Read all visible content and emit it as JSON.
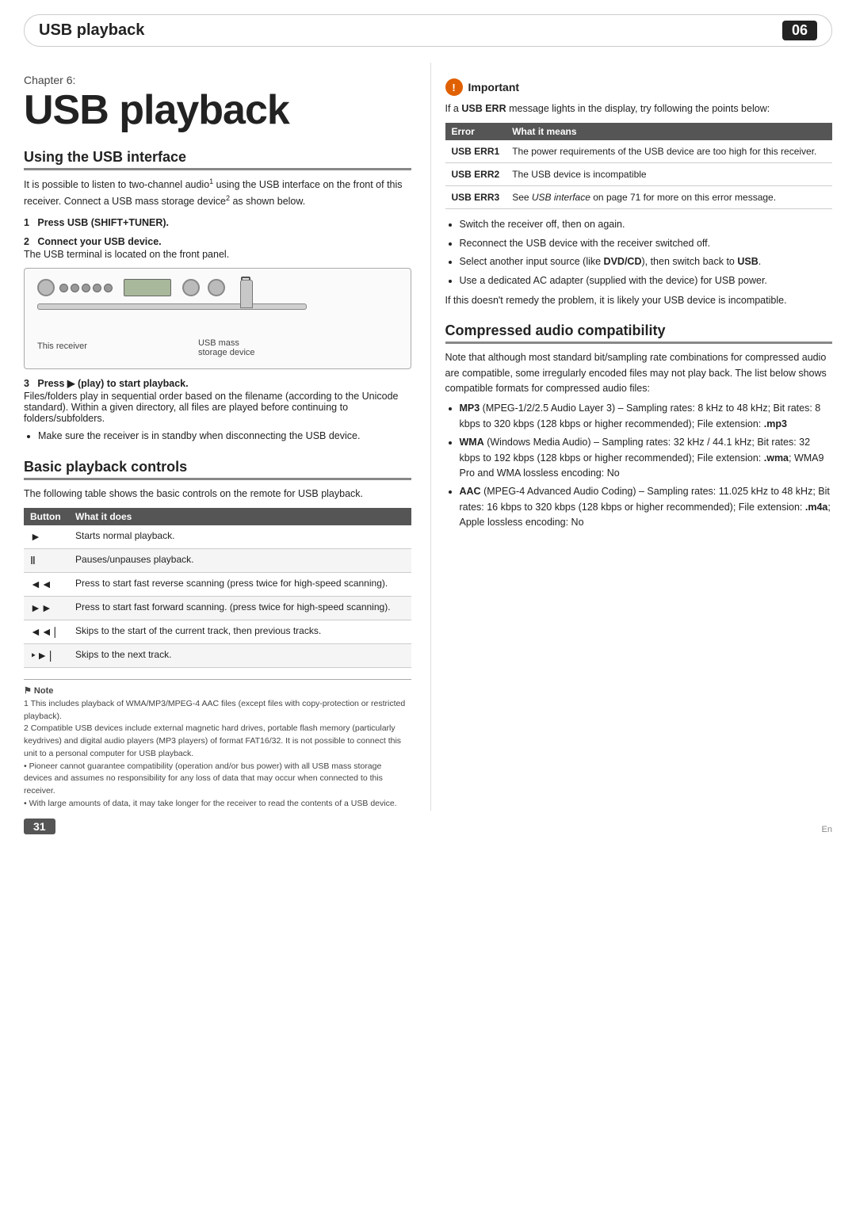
{
  "header": {
    "title": "USB playback",
    "chapter_num": "06"
  },
  "chapter": {
    "label": "Chapter 6:",
    "title": "USB playback"
  },
  "left_col": {
    "section1": {
      "heading": "Using the USB interface",
      "body": "It is possible to listen to two-channel audio¹ using the USB interface on the front of this receiver. Connect a USB mass storage device² as shown below.",
      "step1": {
        "label": "1   Press USB (SHIFT+TUNER)."
      },
      "step2": {
        "label": "2   Connect your USB device.",
        "body": "The USB terminal is located on the front panel."
      },
      "diagram": {
        "receiver_label": "This receiver",
        "usb_label": "USB mass\nstorage device"
      },
      "step3": {
        "label": "3   Press ► (play) to start playback.",
        "body": "Files/folders play in sequential order based on the filename (according to the Unicode standard). Within a given directory, all files are played before continuing to folders/subfolders."
      },
      "bullet": "Make sure the receiver is in standby when disconnecting the USB device."
    },
    "section2": {
      "heading": "Basic playback controls",
      "intro": "The following table shows the basic controls on the remote for USB playback.",
      "table": {
        "col1": "Button",
        "col2": "What it does",
        "rows": [
          {
            "button": "►",
            "desc": "Starts normal playback."
          },
          {
            "button": "Ⅱ",
            "desc": "Pauses/unpauses playback."
          },
          {
            "button": "◄◄",
            "desc": "Press to start fast reverse scanning (press twice for high-speed scanning)."
          },
          {
            "button": "►►",
            "desc": "Press to start fast forward scanning.\n(press twice for high-speed scanning)."
          },
          {
            "button": "◄◄∣",
            "desc": "Skips to the start of the current track, then previous tracks."
          },
          {
            "button": "‣►∣",
            "desc": "Skips to the next track."
          }
        ]
      }
    },
    "note": {
      "title": "Note",
      "lines": [
        "1  This includes playback of WMA/MP3/MPEG-4 AAC files (except files with copy-protection or restricted playback).",
        "2  Compatible USB devices include external magnetic hard drives, portable flash memory (particularly keydrives) and digital audio players (MP3 players) of format FAT16/32. It is not possible to connect this unit to a personal computer for USB playback.",
        "   • Pioneer cannot guarantee compatibility (operation and/or bus power) with all USB mass storage devices and assumes no responsibility for any loss of data that may occur when connected to this receiver.",
        "   • With large amounts of data, it may take longer for the receiver to read the contents of a USB device."
      ]
    }
  },
  "right_col": {
    "important": {
      "header": "Important",
      "intro": "If a USB ERR message lights in the display, try following the points below:",
      "table": {
        "col1": "Error",
        "col2": "What it means",
        "rows": [
          {
            "error": "USB ERR1",
            "desc": "The power requirements of the USB device are too high for this receiver."
          },
          {
            "error": "USB ERR2",
            "desc": "The USB device is incompatible"
          },
          {
            "error": "USB ERR3",
            "desc": "See USB interface on page 71 for more on this error message."
          }
        ]
      },
      "bullets": [
        "Switch the receiver off, then on again.",
        "Reconnect the USB device with the receiver switched off.",
        "Select another input source (like DVD/CD), then switch back to USB.",
        "Use a dedicated AC adapter (supplied with the device) for USB power."
      ],
      "footer_text": "If this doesn't remedy the problem, it is likely your USB device is incompatible."
    },
    "section_compressed": {
      "heading": "Compressed audio compatibility",
      "intro": "Note that although most standard bit/sampling rate combinations for compressed audio are compatible, some irregularly encoded files may not play back. The list below shows compatible formats for compressed audio files:",
      "bullets": [
        {
          "bold_start": "MP3",
          "rest": " (MPEG-1/2/2.5 Audio Layer 3) – Sampling rates: 8 kHz to 48 kHz; Bit rates: 8 kbps to 320 kbps (128 kbps or higher recommended); File extension: .mp3"
        },
        {
          "bold_start": "WMA",
          "rest": " (Windows Media Audio) – Sampling rates: 32 kHz / 44.1 kHz; Bit rates: 32 kbps to 192 kbps (128 kbps or higher recommended); File extension: .wma; WMA9 Pro and WMA lossless encoding: No"
        },
        {
          "bold_start": "AAC",
          "rest": " (MPEG-4 Advanced Audio Coding) – Sampling rates: 11.025 kHz to 48 kHz; Bit rates: 16 kbps to 320 kbps (128 kbps or higher recommended); File extension: .m4a; Apple lossless encoding: No"
        }
      ]
    }
  },
  "footer": {
    "page_number": "31",
    "en_label": "En"
  }
}
